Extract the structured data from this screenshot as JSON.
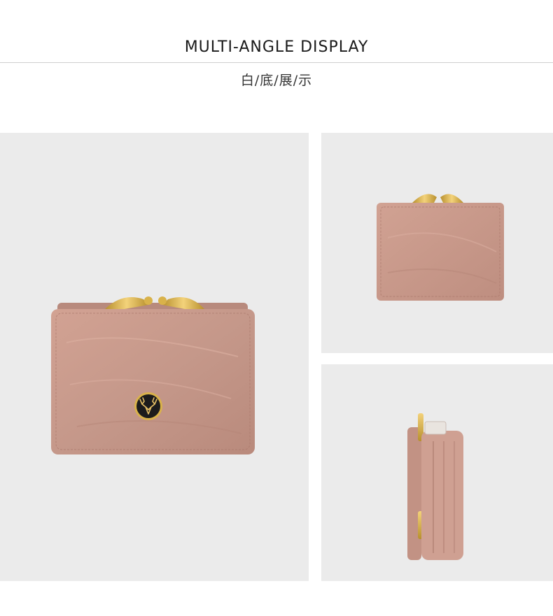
{
  "header": {
    "title": "MULTI-ANGLE DISPLAY",
    "subtitle": "白/底/展/示"
  },
  "colors": {
    "background": "#ffffff",
    "panel": "#ebebeb",
    "leather": "#c9988a",
    "leather_dark": "#a9786b",
    "gold": "#d9b24a",
    "emblem": "#1c1c1c"
  },
  "icons": [
    "deer-emblem-icon"
  ]
}
